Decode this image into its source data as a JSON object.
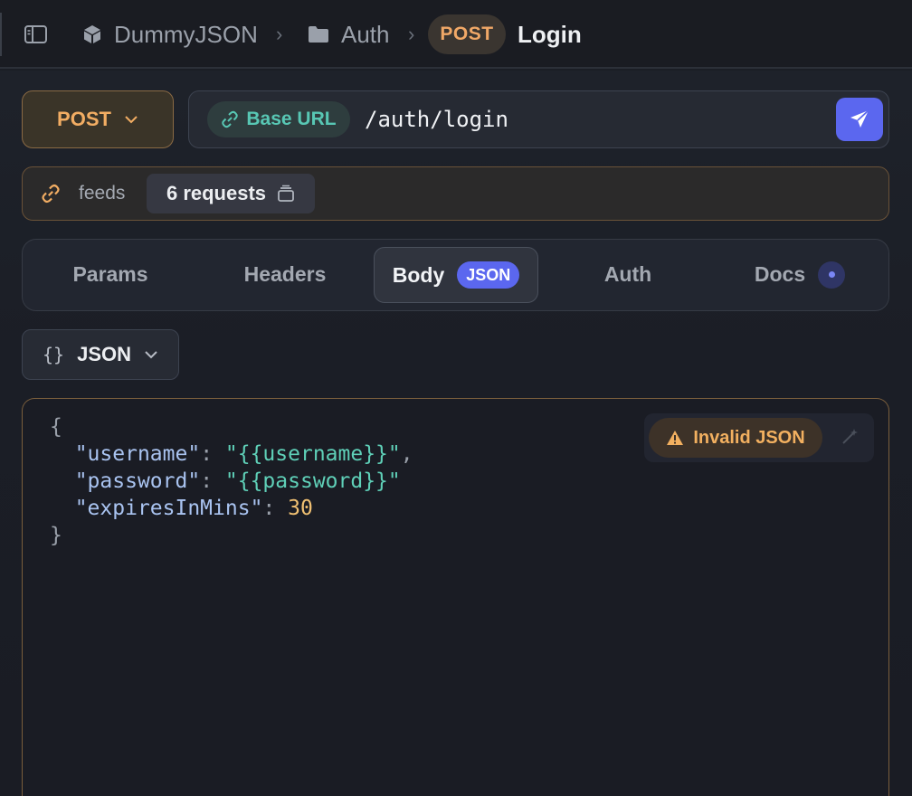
{
  "breadcrumb": {
    "collection": "DummyJSON",
    "folder": "Auth",
    "method": "POST",
    "request_name": "Login"
  },
  "request": {
    "method": "POST",
    "base_url_label": "Base URL",
    "path": "/auth/login"
  },
  "feeds": {
    "label": "feeds",
    "requests_label": "6 requests"
  },
  "tabs": [
    {
      "label": "Params"
    },
    {
      "label": "Headers"
    },
    {
      "label": "Body",
      "badge": "JSON"
    },
    {
      "label": "Auth"
    },
    {
      "label": "Docs"
    }
  ],
  "body_format": {
    "icon_text": "{}",
    "label": "JSON"
  },
  "editor": {
    "lines": [
      {
        "open": "{"
      },
      {
        "key": "\"username\"",
        "sep": ": ",
        "value": "\"{{username}}\"",
        "tail": ","
      },
      {
        "key": "\"password\"",
        "sep": ": ",
        "value": "\"{{password}}\"",
        "tail": ""
      },
      {
        "key": "\"expiresInMins\"",
        "sep": ": ",
        "num": "30",
        "tail": ""
      },
      {
        "close": "}"
      }
    ],
    "status": "Invalid JSON"
  },
  "colors": {
    "accent": "#5b67ef",
    "method": "#f2ad63",
    "base_url": "#58c7b4",
    "warning": "#f2b060"
  }
}
